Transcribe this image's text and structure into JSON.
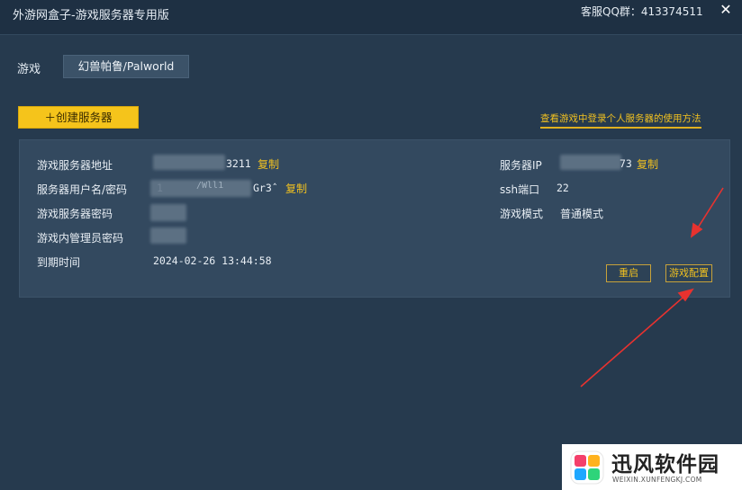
{
  "window": {
    "title": "外游网盒子-游戏服务器专用版",
    "qq_group": "客服QQ群：413374511",
    "close_glyph": "✕"
  },
  "game": {
    "label": "游戏",
    "selected": "幻兽帕鲁/Palworld"
  },
  "actions": {
    "create_server": "＋创建服务器",
    "help_link": "查看游戏中登录个人服务器的使用方法"
  },
  "server": {
    "address_label": "游戏服务器地址",
    "address_value_visible": "3211",
    "username_label": "服务器用户名/密码",
    "username_value_visible_start": "1",
    "username_value_visible_mid": "/Wll1",
    "username_value_visible_end": "Gr3ˆ",
    "game_password_label": "游戏服务器密码",
    "admin_password_label": "游戏内管理员密码",
    "expire_label": "到期时间",
    "expire_value": "2024-02-26 13:44:58",
    "ip_label": "服务器IP",
    "ip_value_visible": "73",
    "ssh_label": "ssh端口",
    "ssh_value": "22",
    "mode_label": "游戏模式",
    "mode_value": "普通模式",
    "copy_label": "复制",
    "restart_button": "重启",
    "config_button": "游戏配置"
  },
  "colors": {
    "background": "#263a4e",
    "titlebar": "#1e3043",
    "panel": "#33495f",
    "accent": "#f5c41b",
    "link": "#f0c020",
    "annotation_arrow": "#e8322f"
  },
  "watermark": {
    "title": "迅风软件园",
    "url": "WEIXIN.XUNFENGKJ.COM"
  }
}
